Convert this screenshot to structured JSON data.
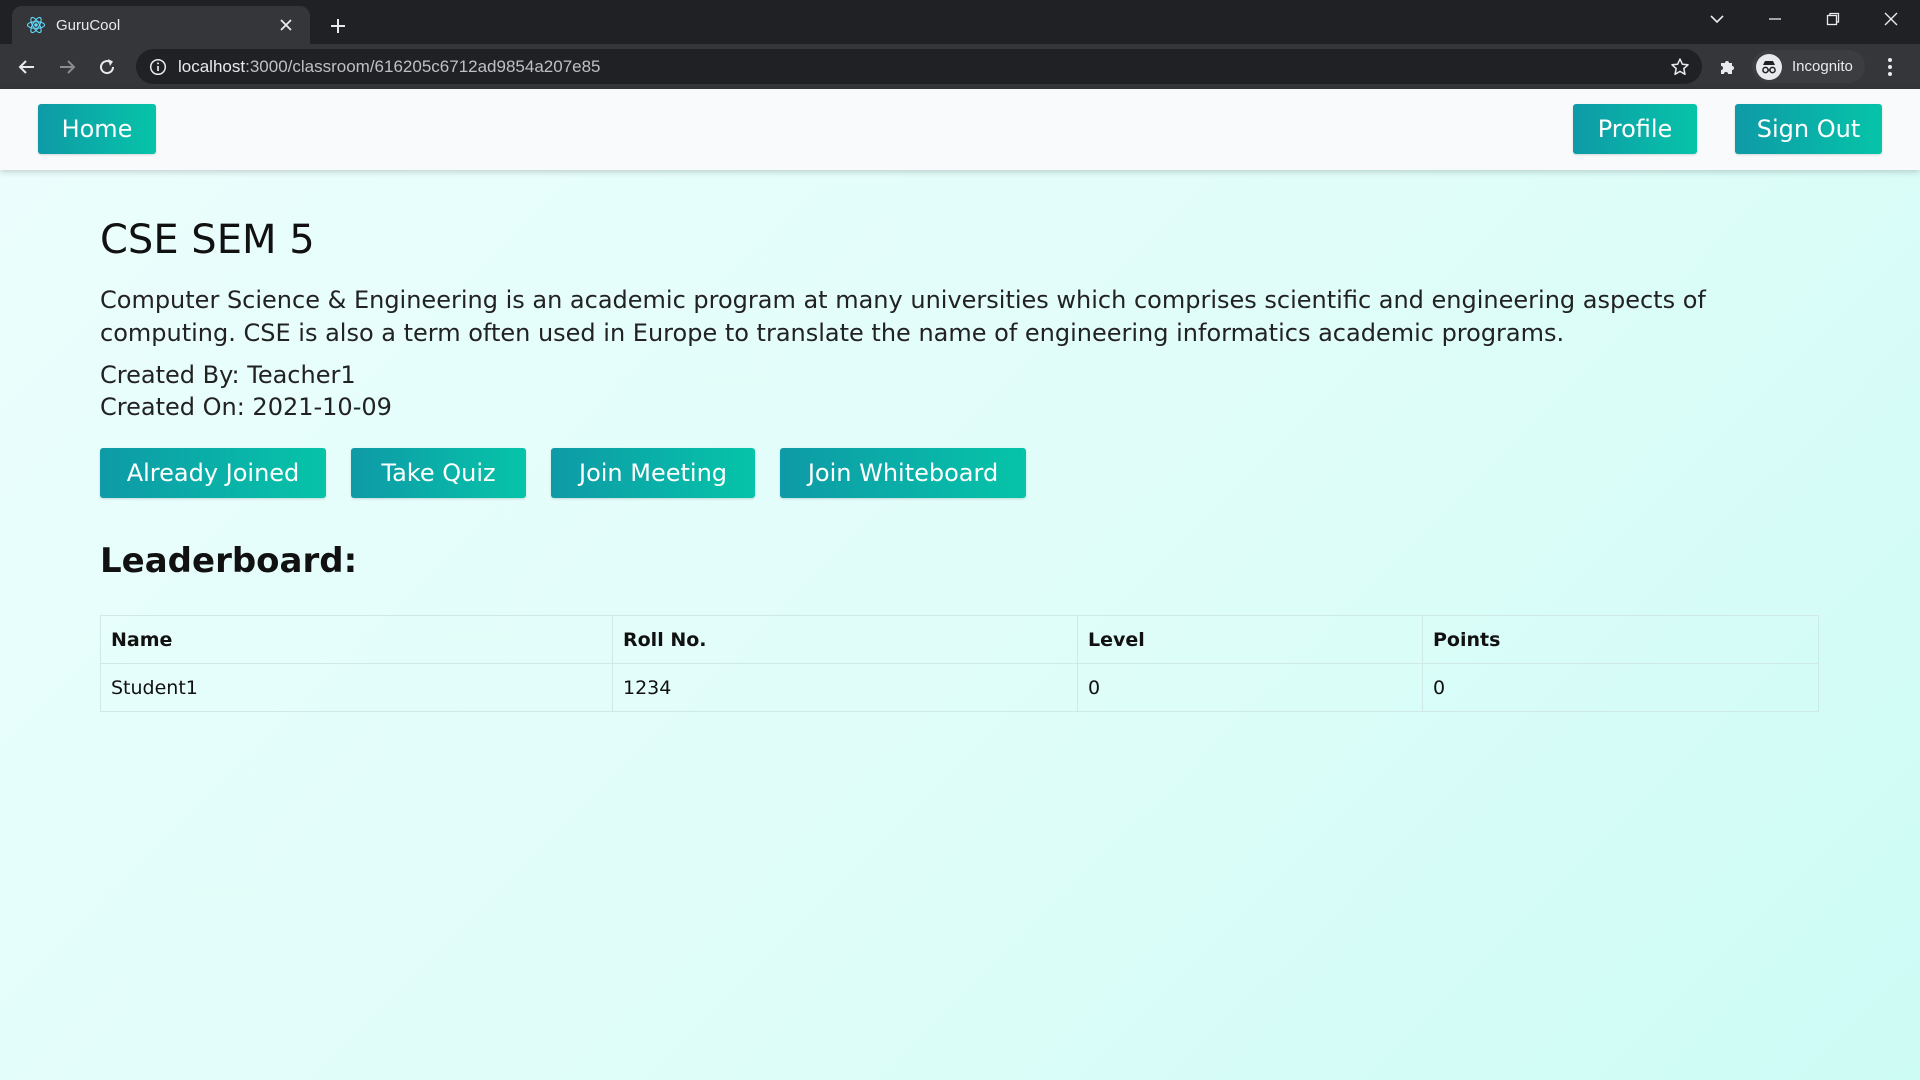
{
  "browser": {
    "tab_title": "GuruCool",
    "url_host": "localhost",
    "url_rest": ":3000/classroom/616205c6712ad9854a207e85",
    "profile_label": "Incognito"
  },
  "nav": {
    "home": "Home",
    "profile": "Profile",
    "signout": "Sign Out"
  },
  "classroom": {
    "title": "CSE SEM 5",
    "description": "Computer Science & Engineering is an academic program at many universities which comprises scientific and engineering aspects of computing. CSE is also a term often used in Europe to translate the name of engineering informatics academic programs.",
    "created_by": "Created By: Teacher1",
    "created_on": "Created On: 2021-10-09"
  },
  "actions": {
    "already_joined": "Already Joined",
    "take_quiz": "Take Quiz",
    "join_meeting": "Join Meeting",
    "join_whiteboard": "Join Whiteboard"
  },
  "leaderboard": {
    "title": "Leaderboard:",
    "headers": [
      "Name",
      "Roll No.",
      "Level",
      "Points"
    ],
    "rows": [
      [
        "Student1",
        "1234",
        "0",
        "0"
      ]
    ]
  },
  "colors": {
    "button_start": "#0e9aa7",
    "button_end": "#06c4a8",
    "page_bg": "#dffdf9"
  }
}
